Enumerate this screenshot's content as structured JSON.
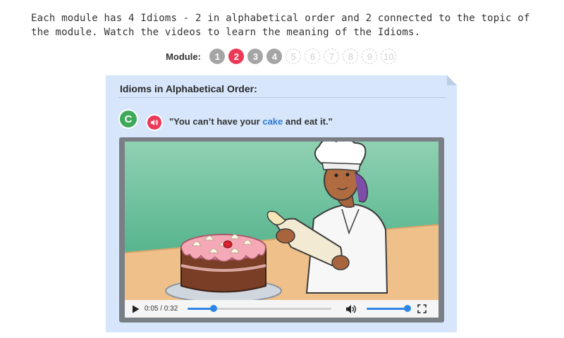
{
  "intro": {
    "text": "Each module has 4 Idioms - 2 in alphabetical order and 2 connected to the topic of the module. Watch the videos to learn the meaning of the Idioms."
  },
  "modules": {
    "label": "Module:",
    "items": [
      {
        "num": "1",
        "state": "available"
      },
      {
        "num": "2",
        "state": "current"
      },
      {
        "num": "3",
        "state": "available"
      },
      {
        "num": "4",
        "state": "available"
      },
      {
        "num": "5",
        "state": "locked"
      },
      {
        "num": "6",
        "state": "locked"
      },
      {
        "num": "7",
        "state": "locked"
      },
      {
        "num": "8",
        "state": "locked"
      },
      {
        "num": "9",
        "state": "locked"
      },
      {
        "num": "10",
        "state": "locked"
      }
    ]
  },
  "card": {
    "title": "Idioms in Alphabetical Order:",
    "letter": "C",
    "idiom_before": "\"You can’t have your ",
    "idiom_keyword": "cake",
    "idiom_after": " and eat it.\""
  },
  "video": {
    "time": "0:05 / 0:32",
    "progress": 0.18,
    "volume": 1.0
  },
  "colors": {
    "accent": "#ec3958",
    "badge_green": "#3ea95a",
    "keyword_blue": "#2c7bd6",
    "slider_blue": "#2d86e6",
    "card_bg": "#d7e6fb"
  }
}
